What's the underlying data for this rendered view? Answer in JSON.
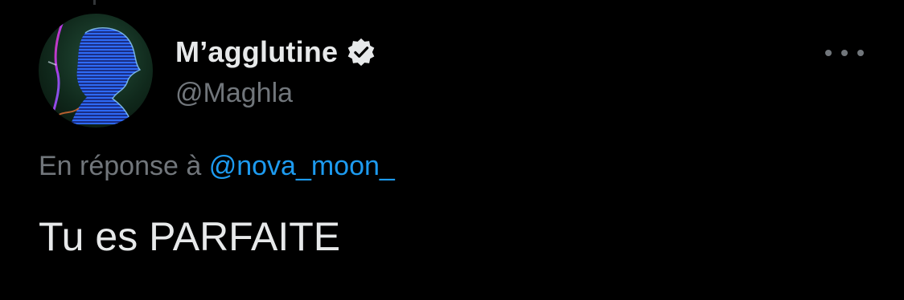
{
  "author": {
    "display_name": "M’agglutine",
    "handle": "@Maghla",
    "verified": true,
    "avatar_icon": "profile-avatar"
  },
  "menu": {
    "icon": "more-options-icon"
  },
  "reply": {
    "prefix": "En réponse à ",
    "to_handle": "@nova_moon_"
  },
  "tweet": {
    "text": "Tu es PARFAITE"
  },
  "colors": {
    "background": "#000000",
    "primary_text": "#e7e9ea",
    "secondary_text": "#71767b",
    "link": "#1d9bf0"
  }
}
